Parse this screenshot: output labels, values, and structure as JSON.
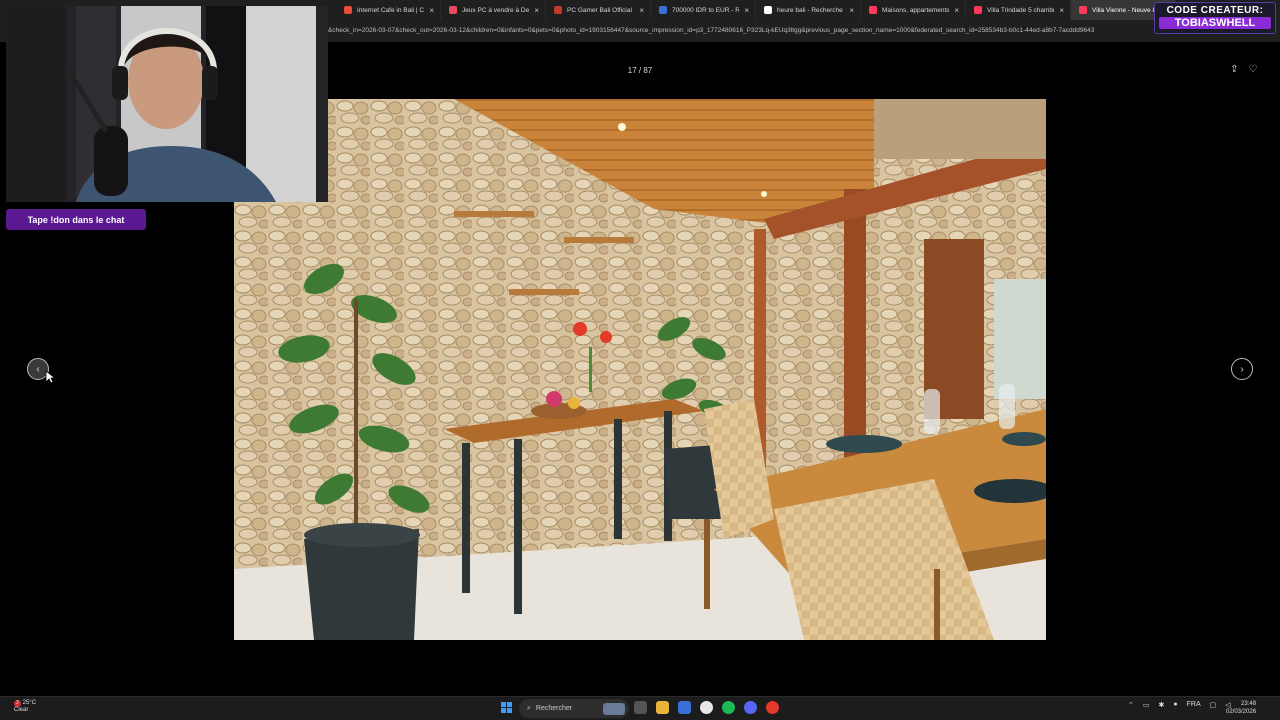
{
  "browser": {
    "tabs": [
      {
        "title": "Internet Cafe in Bali | CYB",
        "color": "#e74c3c"
      },
      {
        "title": "Jeux PC à vendre à Denpa",
        "color": "#e84a5f"
      },
      {
        "title": "PC Gamer Bali Official | Ra",
        "color": "#c0392b"
      },
      {
        "title": "700000 IDR to EUR - Reu",
        "color": "#3b6fd8"
      },
      {
        "title": "heure bali - Recherche Go",
        "color": "#ffffff"
      },
      {
        "title": "Maisons, appartements e",
        "color": "#ff385c"
      },
      {
        "title": "Villa Trindade 5 chambres",
        "color": "#ff385c"
      },
      {
        "title": "Villa Vienne - Neuve 8 Ch",
        "color": "#ff385c",
        "active": true
      }
    ],
    "url": "&check_in=2026-03-07&check_out=2026-03-12&children=0&infants=0&pets=0&photo_id=1903156447&source_impression_id=p3_1772480616_P323Lq-kEUq3ltgg&previous_page_section_name=1000&federated_search_id=258534b3-b0c1-44ed-a8b7-7acddd9643"
  },
  "overlay": {
    "creator_line1": "CODE CREATEUR:",
    "creator_line2": "TOBIASWHELL",
    "chat_button": "Tape !don dans le chat"
  },
  "gallery": {
    "counter": "17 / 87",
    "share_icon": "share-icon",
    "heart_icon": "heart-icon",
    "prev_glyph": "‹",
    "next_glyph": "›"
  },
  "taskbar": {
    "weather_temp": "25°C",
    "weather_desc": "Clear",
    "weather_badge": "2",
    "search_placeholder": "Rechercher",
    "lang": "FRA",
    "time": "23:48",
    "date": "02/03/2026"
  }
}
